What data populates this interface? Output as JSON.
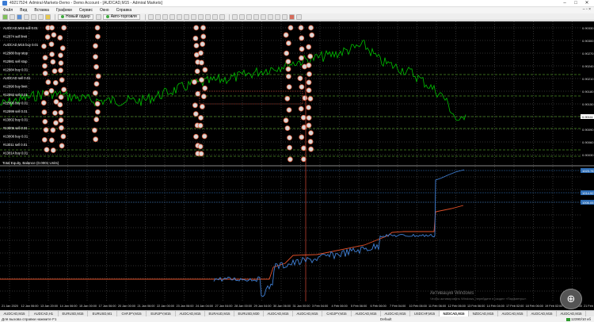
{
  "window": {
    "title": "49217524: Admiral-Markets-Demo - Demo Account - [AUDCAD,M15 - Admiral Markets]",
    "controls": [
      "–",
      "□",
      "✕"
    ]
  },
  "menu": {
    "items": [
      "Файл",
      "Вид",
      "Вставка",
      "Графики",
      "Сервис",
      "Окно",
      "Справка"
    ],
    "mdi_controls": "– ▫ ×"
  },
  "toolbar": {
    "new_order": "Новый ордер",
    "autotrading": "Авто-торговля"
  },
  "chart": {
    "indicator_label": "Total Equity, Balance (0.0001 Units)",
    "price_labels": [
      "0.90330",
      "0.90300",
      "0.90270",
      "0.90240",
      "0.90210",
      "0.90180",
      "0.90150",
      "0.90120",
      "0.90090",
      "0.90060",
      "0.90030"
    ],
    "current_price": "0.90111",
    "subwindow_labels": [
      "1023.78",
      "1014.92",
      "1006.05"
    ],
    "time_labels": [
      "21 Jan 2020",
      "12 Jan 06:00",
      "13 Jan 20:00",
      "14 Jan 06:00",
      "15 Jan 00:00",
      "17 Jan 06:00",
      "20 Jan 00:00",
      "21 Jan 06:00",
      "22 Jan 00:00",
      "23 Jan 06:00",
      "24 Jan 04:00",
      "27 Jan 04:00",
      "28 Jan 00:00",
      "29 Jan 04:00",
      "30 Jan 06:00",
      "31 Jan 00:00",
      "3 Feb 04:00",
      "4 Feb 06:00",
      "5 Feb 06:00",
      "6 Feb 06:00",
      "7 Feb 04:00",
      "10 Feb 06:00",
      "11 Feb 06:00",
      "12 Feb 06:00",
      "13 Feb 06:00",
      "14 Feb 04:00",
      "17 Feb 02:00",
      "18 Feb 06:00",
      "19 Feb 02:00",
      "20 Feb 06:00",
      "21 Feb 02:00"
    ],
    "trade_labels": [
      "AUDCAD,M15 sell 0.01",
      "#12974 sell limit",
      "AUDCAD,M15 buy 0.01",
      "#12980 buy stop",
      "#12981 sell stop",
      "#12984 buy 0.01",
      "AUDCAD sell 0.01",
      "#12990 buy limit",
      "#12993 sell 0.01",
      "#12996 buy 0.01",
      "#12999 sell 0.01",
      "#13002 buy 0.01",
      "#13005 sell 0.01",
      "#13008 buy 0.01",
      "#13011 sell 0.01",
      "#13014 buy 0.01"
    ]
  },
  "tabs": [
    "AUDCAD,M15",
    "AUDCAD,H1",
    "EURUSD,M15",
    "EURUSD,M1",
    "CHFJPY,M15",
    "EURJPY,M15",
    "AUDCAD,M15",
    "EURAUD,M15",
    "EURUSD,M30",
    "AUDCAD,M15",
    "AUDCAD,M15",
    "CADJPY,M15",
    "AUDCAD,M15",
    "AUDCAD,M15",
    "USDCHF,M15",
    "NZDCAD,M15",
    "NZDCAD,M15",
    "AUDCAD,M15",
    "AUDCAD,M15",
    "AUDCAD,M15"
  ],
  "active_tab_index": 15,
  "status": {
    "left": "Для вызова справки нажмите F1",
    "mid": "Default",
    "right": "12390/10 кб"
  },
  "activation": {
    "title": "Активация Windows",
    "subtitle": "Чтобы активировать Windows, перейдите в раздел «Параметры»."
  },
  "colors": {
    "price_line": "#00c000",
    "equity_line": "#3f7fd4",
    "balance_line": "#e0502a",
    "grid_line": "#606060",
    "level_line": "#6ecf3a",
    "subwindow_level": "#2f6fb8"
  }
}
